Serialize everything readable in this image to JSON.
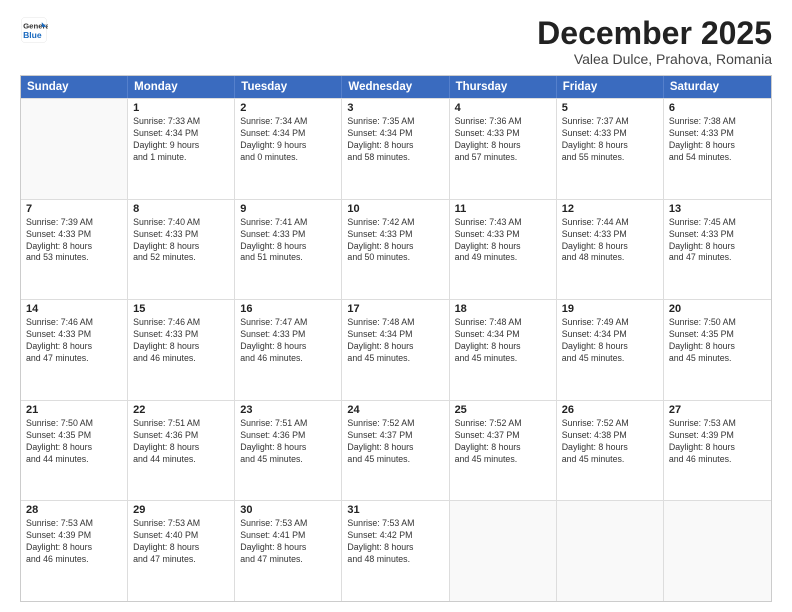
{
  "header": {
    "logo_line1": "General",
    "logo_line2": "Blue",
    "month": "December 2025",
    "location": "Valea Dulce, Prahova, Romania"
  },
  "weekdays": [
    "Sunday",
    "Monday",
    "Tuesday",
    "Wednesday",
    "Thursday",
    "Friday",
    "Saturday"
  ],
  "rows": [
    [
      {
        "day": "",
        "info": ""
      },
      {
        "day": "1",
        "info": "Sunrise: 7:33 AM\nSunset: 4:34 PM\nDaylight: 9 hours\nand 1 minute."
      },
      {
        "day": "2",
        "info": "Sunrise: 7:34 AM\nSunset: 4:34 PM\nDaylight: 9 hours\nand 0 minutes."
      },
      {
        "day": "3",
        "info": "Sunrise: 7:35 AM\nSunset: 4:34 PM\nDaylight: 8 hours\nand 58 minutes."
      },
      {
        "day": "4",
        "info": "Sunrise: 7:36 AM\nSunset: 4:33 PM\nDaylight: 8 hours\nand 57 minutes."
      },
      {
        "day": "5",
        "info": "Sunrise: 7:37 AM\nSunset: 4:33 PM\nDaylight: 8 hours\nand 55 minutes."
      },
      {
        "day": "6",
        "info": "Sunrise: 7:38 AM\nSunset: 4:33 PM\nDaylight: 8 hours\nand 54 minutes."
      }
    ],
    [
      {
        "day": "7",
        "info": "Sunrise: 7:39 AM\nSunset: 4:33 PM\nDaylight: 8 hours\nand 53 minutes."
      },
      {
        "day": "8",
        "info": "Sunrise: 7:40 AM\nSunset: 4:33 PM\nDaylight: 8 hours\nand 52 minutes."
      },
      {
        "day": "9",
        "info": "Sunrise: 7:41 AM\nSunset: 4:33 PM\nDaylight: 8 hours\nand 51 minutes."
      },
      {
        "day": "10",
        "info": "Sunrise: 7:42 AM\nSunset: 4:33 PM\nDaylight: 8 hours\nand 50 minutes."
      },
      {
        "day": "11",
        "info": "Sunrise: 7:43 AM\nSunset: 4:33 PM\nDaylight: 8 hours\nand 49 minutes."
      },
      {
        "day": "12",
        "info": "Sunrise: 7:44 AM\nSunset: 4:33 PM\nDaylight: 8 hours\nand 48 minutes."
      },
      {
        "day": "13",
        "info": "Sunrise: 7:45 AM\nSunset: 4:33 PM\nDaylight: 8 hours\nand 47 minutes."
      }
    ],
    [
      {
        "day": "14",
        "info": "Sunrise: 7:46 AM\nSunset: 4:33 PM\nDaylight: 8 hours\nand 47 minutes."
      },
      {
        "day": "15",
        "info": "Sunrise: 7:46 AM\nSunset: 4:33 PM\nDaylight: 8 hours\nand 46 minutes."
      },
      {
        "day": "16",
        "info": "Sunrise: 7:47 AM\nSunset: 4:33 PM\nDaylight: 8 hours\nand 46 minutes."
      },
      {
        "day": "17",
        "info": "Sunrise: 7:48 AM\nSunset: 4:34 PM\nDaylight: 8 hours\nand 45 minutes."
      },
      {
        "day": "18",
        "info": "Sunrise: 7:48 AM\nSunset: 4:34 PM\nDaylight: 8 hours\nand 45 minutes."
      },
      {
        "day": "19",
        "info": "Sunrise: 7:49 AM\nSunset: 4:34 PM\nDaylight: 8 hours\nand 45 minutes."
      },
      {
        "day": "20",
        "info": "Sunrise: 7:50 AM\nSunset: 4:35 PM\nDaylight: 8 hours\nand 45 minutes."
      }
    ],
    [
      {
        "day": "21",
        "info": "Sunrise: 7:50 AM\nSunset: 4:35 PM\nDaylight: 8 hours\nand 44 minutes."
      },
      {
        "day": "22",
        "info": "Sunrise: 7:51 AM\nSunset: 4:36 PM\nDaylight: 8 hours\nand 44 minutes."
      },
      {
        "day": "23",
        "info": "Sunrise: 7:51 AM\nSunset: 4:36 PM\nDaylight: 8 hours\nand 45 minutes."
      },
      {
        "day": "24",
        "info": "Sunrise: 7:52 AM\nSunset: 4:37 PM\nDaylight: 8 hours\nand 45 minutes."
      },
      {
        "day": "25",
        "info": "Sunrise: 7:52 AM\nSunset: 4:37 PM\nDaylight: 8 hours\nand 45 minutes."
      },
      {
        "day": "26",
        "info": "Sunrise: 7:52 AM\nSunset: 4:38 PM\nDaylight: 8 hours\nand 45 minutes."
      },
      {
        "day": "27",
        "info": "Sunrise: 7:53 AM\nSunset: 4:39 PM\nDaylight: 8 hours\nand 46 minutes."
      }
    ],
    [
      {
        "day": "28",
        "info": "Sunrise: 7:53 AM\nSunset: 4:39 PM\nDaylight: 8 hours\nand 46 minutes."
      },
      {
        "day": "29",
        "info": "Sunrise: 7:53 AM\nSunset: 4:40 PM\nDaylight: 8 hours\nand 47 minutes."
      },
      {
        "day": "30",
        "info": "Sunrise: 7:53 AM\nSunset: 4:41 PM\nDaylight: 8 hours\nand 47 minutes."
      },
      {
        "day": "31",
        "info": "Sunrise: 7:53 AM\nSunset: 4:42 PM\nDaylight: 8 hours\nand 48 minutes."
      },
      {
        "day": "",
        "info": ""
      },
      {
        "day": "",
        "info": ""
      },
      {
        "day": "",
        "info": ""
      }
    ]
  ]
}
